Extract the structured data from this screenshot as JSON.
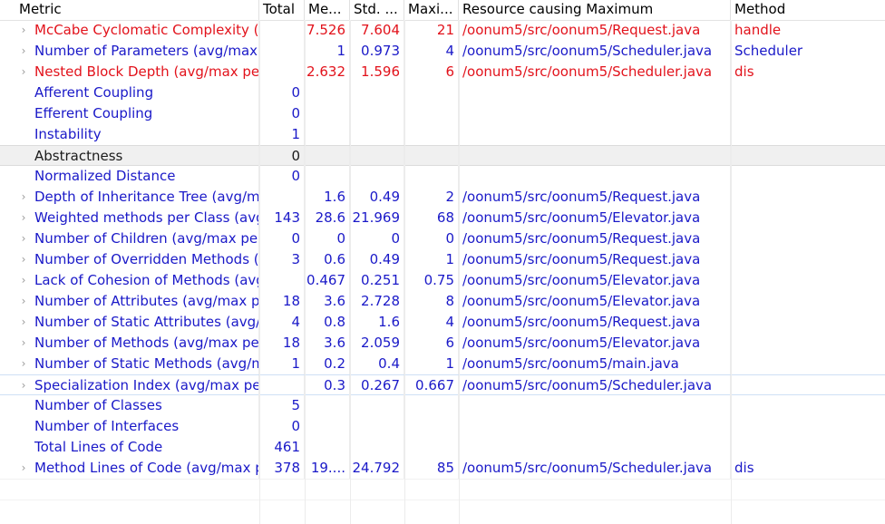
{
  "columns": {
    "metric": "Metric",
    "total": "Total",
    "mean": "Me...",
    "std": "Std. ...",
    "max": "Maxi...",
    "resource": "Resource causing Maximum",
    "method": "Method"
  },
  "colors": {
    "red": "#e2121b",
    "blue": "#1a19c8",
    "black": "#1b1b1b"
  },
  "rows": [
    {
      "metric": "McCabe Cyclomatic Complexity (avg/max per method)",
      "total": "",
      "mean": "7.526",
      "std": "7.604",
      "max": "21",
      "resource": "/oonum5/src/oonum5/Request.java",
      "method": "handle",
      "color": "red",
      "expandable": true
    },
    {
      "metric": "Number of Parameters (avg/max per method)",
      "total": "",
      "mean": "1",
      "std": "0.973",
      "max": "4",
      "resource": "/oonum5/src/oonum5/Scheduler.java",
      "method": "Scheduler",
      "color": "blue",
      "expandable": true
    },
    {
      "metric": "Nested Block Depth (avg/max per method)",
      "total": "",
      "mean": "2.632",
      "std": "1.596",
      "max": "6",
      "resource": "/oonum5/src/oonum5/Scheduler.java",
      "method": "dis",
      "color": "red",
      "expandable": true
    },
    {
      "metric": "Afferent Coupling",
      "total": "0",
      "mean": "",
      "std": "",
      "max": "",
      "resource": "",
      "method": "",
      "color": "blue",
      "expandable": false
    },
    {
      "metric": "Efferent Coupling",
      "total": "0",
      "mean": "",
      "std": "",
      "max": "",
      "resource": "",
      "method": "",
      "color": "blue",
      "expandable": false
    },
    {
      "metric": "Instability",
      "total": "1",
      "mean": "",
      "std": "",
      "max": "",
      "resource": "",
      "method": "",
      "color": "blue",
      "expandable": false
    },
    {
      "metric": "Abstractness",
      "total": "0",
      "mean": "",
      "std": "",
      "max": "",
      "resource": "",
      "method": "",
      "color": "black",
      "expandable": false,
      "selected": true
    },
    {
      "metric": "Normalized Distance",
      "total": "0",
      "mean": "",
      "std": "",
      "max": "",
      "resource": "",
      "method": "",
      "color": "blue",
      "expandable": false
    },
    {
      "metric": "Depth of Inheritance Tree (avg/max per type)",
      "total": "",
      "mean": "1.6",
      "std": "0.49",
      "max": "2",
      "resource": "/oonum5/src/oonum5/Request.java",
      "method": "",
      "color": "blue",
      "expandable": true
    },
    {
      "metric": "Weighted methods per Class (avg/max per type)",
      "total": "143",
      "mean": "28.6",
      "std": "21.969",
      "max": "68",
      "resource": "/oonum5/src/oonum5/Elevator.java",
      "method": "",
      "color": "blue",
      "expandable": true
    },
    {
      "metric": "Number of Children (avg/max per type)",
      "total": "0",
      "mean": "0",
      "std": "0",
      "max": "0",
      "resource": "/oonum5/src/oonum5/Request.java",
      "method": "",
      "color": "blue",
      "expandable": true
    },
    {
      "metric": "Number of Overridden Methods (avg/max per type)",
      "total": "3",
      "mean": "0.6",
      "std": "0.49",
      "max": "1",
      "resource": "/oonum5/src/oonum5/Request.java",
      "method": "",
      "color": "blue",
      "expandable": true
    },
    {
      "metric": "Lack of Cohesion of Methods (avg/max per type)",
      "total": "",
      "mean": "0.467",
      "std": "0.251",
      "max": "0.75",
      "resource": "/oonum5/src/oonum5/Elevator.java",
      "method": "",
      "color": "blue",
      "expandable": true
    },
    {
      "metric": "Number of Attributes (avg/max per type)",
      "total": "18",
      "mean": "3.6",
      "std": "2.728",
      "max": "8",
      "resource": "/oonum5/src/oonum5/Elevator.java",
      "method": "",
      "color": "blue",
      "expandable": true
    },
    {
      "metric": "Number of Static Attributes (avg/max per type)",
      "total": "4",
      "mean": "0.8",
      "std": "1.6",
      "max": "4",
      "resource": "/oonum5/src/oonum5/Request.java",
      "method": "",
      "color": "blue",
      "expandable": true
    },
    {
      "metric": "Number of Methods (avg/max per type)",
      "total": "18",
      "mean": "3.6",
      "std": "2.059",
      "max": "6",
      "resource": "/oonum5/src/oonum5/Elevator.java",
      "method": "",
      "color": "blue",
      "expandable": true
    },
    {
      "metric": "Number of Static Methods (avg/max per type)",
      "total": "1",
      "mean": "0.2",
      "std": "0.4",
      "max": "1",
      "resource": "/oonum5/src/oonum5/main.java",
      "method": "",
      "color": "blue",
      "expandable": true
    },
    {
      "metric": "Specialization Index (avg/max per type)",
      "total": "",
      "mean": "0.3",
      "std": "0.267",
      "max": "0.667",
      "resource": "/oonum5/src/oonum5/Scheduler.java",
      "method": "",
      "color": "blue",
      "expandable": true,
      "focused": true
    },
    {
      "metric": "Number of Classes",
      "total": "5",
      "mean": "",
      "std": "",
      "max": "",
      "resource": "",
      "method": "",
      "color": "blue",
      "expandable": false
    },
    {
      "metric": "Number of Interfaces",
      "total": "0",
      "mean": "",
      "std": "",
      "max": "",
      "resource": "",
      "method": "",
      "color": "blue",
      "expandable": false
    },
    {
      "metric": "Total Lines of Code",
      "total": "461",
      "mean": "",
      "std": "",
      "max": "",
      "resource": "",
      "method": "",
      "color": "blue",
      "expandable": false
    },
    {
      "metric": "Method Lines of Code (avg/max per method)",
      "total": "378",
      "mean": "19....",
      "std": "24.792",
      "max": "85",
      "resource": "/oonum5/src/oonum5/Scheduler.java",
      "method": "dis",
      "color": "blue",
      "expandable": true
    }
  ]
}
